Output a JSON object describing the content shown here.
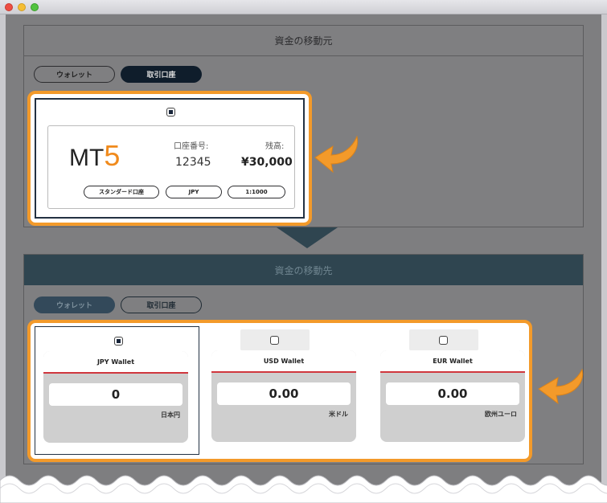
{
  "from_panel": {
    "title": "資金の移動元",
    "tabs": [
      {
        "label": "ウォレット",
        "active": false
      },
      {
        "label": "取引口座",
        "active": true
      }
    ],
    "account": {
      "logo_text": "MT",
      "logo_number": "5",
      "number_label": "口座番号:",
      "number": "12345",
      "balance_label": "残高:",
      "balance": "¥30,000",
      "tags": [
        "スタンダード口座",
        "JPY",
        "1:1000"
      ]
    }
  },
  "to_panel": {
    "title": "資金の移動先",
    "tabs": [
      {
        "label": "ウォレット",
        "active": true
      },
      {
        "label": "取引口座",
        "active": false
      }
    ],
    "wallets": [
      {
        "name": "JPY Wallet",
        "amount": "0",
        "currency": "日本円",
        "selected": true
      },
      {
        "name": "USD Wallet",
        "amount": "0.00",
        "currency": "米ドル",
        "selected": false
      },
      {
        "name": "EUR Wallet",
        "amount": "0.00",
        "currency": "欧州ユーロ",
        "selected": false
      }
    ]
  },
  "colors": {
    "highlight": "#f39a2a",
    "header_dark": "#2f4550",
    "mt5_orange": "#f08a1c",
    "wallet_divider": "#d0373e"
  }
}
